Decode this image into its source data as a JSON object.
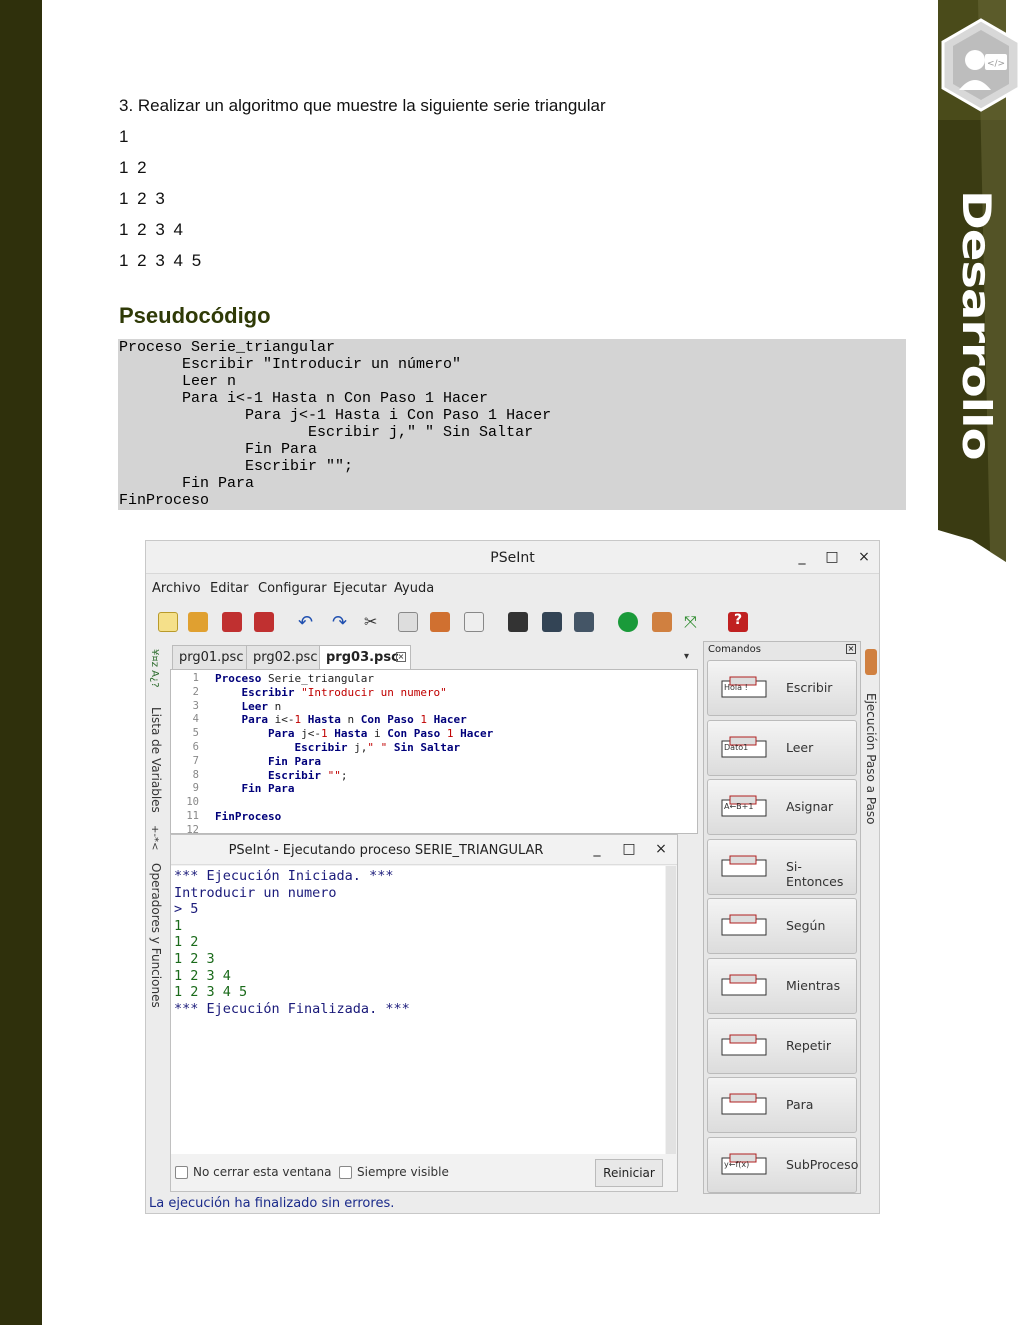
{
  "document": {
    "task": "3. Realizar un algoritmo que muestre la siguiente serie triangular",
    "series": [
      "1",
      "1 2",
      "1 2 3",
      "1 2 3 4",
      "1 2 3 4 5"
    ],
    "section_title": "Pseudocódigo",
    "pseudocode": "Proceso Serie_triangular\n       Escribir \"Introducir un número\"\n       Leer n\n       Para i<-1 Hasta n Con Paso 1 Hacer\n              Para j<-1 Hasta i Con Paso 1 Hacer\n                     Escribir j,\" \" Sin Saltar\n              Fin Para\n              Escribir \"\";\n       Fin Para\nFinProceso",
    "banner": "Desarrollo"
  },
  "app": {
    "title": "PSeInt",
    "window_buttons": [
      "_",
      "□",
      "×"
    ],
    "menu": [
      "Archivo",
      "Editar",
      "Configurar",
      "Ejecutar",
      "Ayuda"
    ],
    "left_panel_labels": [
      "Lista de Variables",
      "Operadores y Funciones"
    ],
    "right_panel_label": "Ejecución Paso a Paso",
    "tabs": [
      "prg01.psc",
      "prg02.psc",
      "prg03.psc"
    ],
    "line_numbers": [
      "1",
      "2",
      "3",
      "4",
      "5",
      "6",
      "7",
      "8",
      "9",
      "10",
      "11",
      "12"
    ],
    "code_lines": [
      "Proceso Serie_triangular",
      "    Escribir \"Introducir un numero\"",
      "    Leer n",
      "    Para i<-1 Hasta n Con Paso 1 Hacer",
      "        Para j<-1 Hasta i Con Paso 1 Hacer",
      "            Escribir j,\" \" Sin Saltar",
      "        Fin Para",
      "        Escribir \"\";",
      "    Fin Para",
      "",
      "FinProceso",
      ""
    ],
    "run_window": {
      "title": "PSeInt - Ejecutando proceso SERIE_TRIANGULAR",
      "output": [
        "*** Ejecución Iniciada. ***",
        "Introducir un numero",
        "> 5",
        "1",
        "1 2",
        "1 2 3",
        "1 2 3 4",
        "1 2 3 4 5",
        "*** Ejecución Finalizada. ***"
      ],
      "no_close_label": "No cerrar esta ventana",
      "always_visible_label": "Siempre visible",
      "restart_label": "Reiniciar"
    },
    "status": "La ejecución ha finalizado sin errores.",
    "commands_title": "Comandos",
    "commands": [
      {
        "label": "Escribir",
        "icon_text": "Hola !"
      },
      {
        "label": "Leer",
        "icon_text": "Dato1"
      },
      {
        "label": "Asignar",
        "icon_text": "A←B+1"
      },
      {
        "label": "Si-Entonces",
        "icon_text": ""
      },
      {
        "label": "Según",
        "icon_text": ""
      },
      {
        "label": "Mientras",
        "icon_text": ""
      },
      {
        "label": "Repetir",
        "icon_text": ""
      },
      {
        "label": "Para",
        "icon_text": ""
      },
      {
        "label": "SubProceso",
        "icon_text": "y←f(x)"
      }
    ],
    "colors": {
      "banner": "#3a3b12",
      "left_bar": "#2f300c",
      "heading": "#2f3a07",
      "code_bg": "#d4d4d4"
    }
  }
}
